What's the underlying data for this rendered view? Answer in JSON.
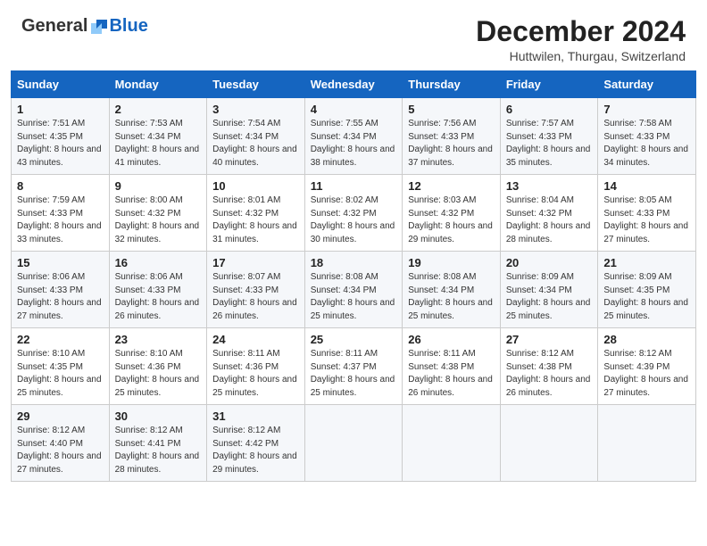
{
  "header": {
    "logo_general": "General",
    "logo_blue": "Blue",
    "month_title": "December 2024",
    "location": "Huttwilen, Thurgau, Switzerland"
  },
  "days_of_week": [
    "Sunday",
    "Monday",
    "Tuesday",
    "Wednesday",
    "Thursday",
    "Friday",
    "Saturday"
  ],
  "weeks": [
    [
      {
        "day": "1",
        "sunrise": "Sunrise: 7:51 AM",
        "sunset": "Sunset: 4:35 PM",
        "daylight": "Daylight: 8 hours and 43 minutes."
      },
      {
        "day": "2",
        "sunrise": "Sunrise: 7:53 AM",
        "sunset": "Sunset: 4:34 PM",
        "daylight": "Daylight: 8 hours and 41 minutes."
      },
      {
        "day": "3",
        "sunrise": "Sunrise: 7:54 AM",
        "sunset": "Sunset: 4:34 PM",
        "daylight": "Daylight: 8 hours and 40 minutes."
      },
      {
        "day": "4",
        "sunrise": "Sunrise: 7:55 AM",
        "sunset": "Sunset: 4:34 PM",
        "daylight": "Daylight: 8 hours and 38 minutes."
      },
      {
        "day": "5",
        "sunrise": "Sunrise: 7:56 AM",
        "sunset": "Sunset: 4:33 PM",
        "daylight": "Daylight: 8 hours and 37 minutes."
      },
      {
        "day": "6",
        "sunrise": "Sunrise: 7:57 AM",
        "sunset": "Sunset: 4:33 PM",
        "daylight": "Daylight: 8 hours and 35 minutes."
      },
      {
        "day": "7",
        "sunrise": "Sunrise: 7:58 AM",
        "sunset": "Sunset: 4:33 PM",
        "daylight": "Daylight: 8 hours and 34 minutes."
      }
    ],
    [
      {
        "day": "8",
        "sunrise": "Sunrise: 7:59 AM",
        "sunset": "Sunset: 4:33 PM",
        "daylight": "Daylight: 8 hours and 33 minutes."
      },
      {
        "day": "9",
        "sunrise": "Sunrise: 8:00 AM",
        "sunset": "Sunset: 4:32 PM",
        "daylight": "Daylight: 8 hours and 32 minutes."
      },
      {
        "day": "10",
        "sunrise": "Sunrise: 8:01 AM",
        "sunset": "Sunset: 4:32 PM",
        "daylight": "Daylight: 8 hours and 31 minutes."
      },
      {
        "day": "11",
        "sunrise": "Sunrise: 8:02 AM",
        "sunset": "Sunset: 4:32 PM",
        "daylight": "Daylight: 8 hours and 30 minutes."
      },
      {
        "day": "12",
        "sunrise": "Sunrise: 8:03 AM",
        "sunset": "Sunset: 4:32 PM",
        "daylight": "Daylight: 8 hours and 29 minutes."
      },
      {
        "day": "13",
        "sunrise": "Sunrise: 8:04 AM",
        "sunset": "Sunset: 4:32 PM",
        "daylight": "Daylight: 8 hours and 28 minutes."
      },
      {
        "day": "14",
        "sunrise": "Sunrise: 8:05 AM",
        "sunset": "Sunset: 4:33 PM",
        "daylight": "Daylight: 8 hours and 27 minutes."
      }
    ],
    [
      {
        "day": "15",
        "sunrise": "Sunrise: 8:06 AM",
        "sunset": "Sunset: 4:33 PM",
        "daylight": "Daylight: 8 hours and 27 minutes."
      },
      {
        "day": "16",
        "sunrise": "Sunrise: 8:06 AM",
        "sunset": "Sunset: 4:33 PM",
        "daylight": "Daylight: 8 hours and 26 minutes."
      },
      {
        "day": "17",
        "sunrise": "Sunrise: 8:07 AM",
        "sunset": "Sunset: 4:33 PM",
        "daylight": "Daylight: 8 hours and 26 minutes."
      },
      {
        "day": "18",
        "sunrise": "Sunrise: 8:08 AM",
        "sunset": "Sunset: 4:34 PM",
        "daylight": "Daylight: 8 hours and 25 minutes."
      },
      {
        "day": "19",
        "sunrise": "Sunrise: 8:08 AM",
        "sunset": "Sunset: 4:34 PM",
        "daylight": "Daylight: 8 hours and 25 minutes."
      },
      {
        "day": "20",
        "sunrise": "Sunrise: 8:09 AM",
        "sunset": "Sunset: 4:34 PM",
        "daylight": "Daylight: 8 hours and 25 minutes."
      },
      {
        "day": "21",
        "sunrise": "Sunrise: 8:09 AM",
        "sunset": "Sunset: 4:35 PM",
        "daylight": "Daylight: 8 hours and 25 minutes."
      }
    ],
    [
      {
        "day": "22",
        "sunrise": "Sunrise: 8:10 AM",
        "sunset": "Sunset: 4:35 PM",
        "daylight": "Daylight: 8 hours and 25 minutes."
      },
      {
        "day": "23",
        "sunrise": "Sunrise: 8:10 AM",
        "sunset": "Sunset: 4:36 PM",
        "daylight": "Daylight: 8 hours and 25 minutes."
      },
      {
        "day": "24",
        "sunrise": "Sunrise: 8:11 AM",
        "sunset": "Sunset: 4:36 PM",
        "daylight": "Daylight: 8 hours and 25 minutes."
      },
      {
        "day": "25",
        "sunrise": "Sunrise: 8:11 AM",
        "sunset": "Sunset: 4:37 PM",
        "daylight": "Daylight: 8 hours and 25 minutes."
      },
      {
        "day": "26",
        "sunrise": "Sunrise: 8:11 AM",
        "sunset": "Sunset: 4:38 PM",
        "daylight": "Daylight: 8 hours and 26 minutes."
      },
      {
        "day": "27",
        "sunrise": "Sunrise: 8:12 AM",
        "sunset": "Sunset: 4:38 PM",
        "daylight": "Daylight: 8 hours and 26 minutes."
      },
      {
        "day": "28",
        "sunrise": "Sunrise: 8:12 AM",
        "sunset": "Sunset: 4:39 PM",
        "daylight": "Daylight: 8 hours and 27 minutes."
      }
    ],
    [
      {
        "day": "29",
        "sunrise": "Sunrise: 8:12 AM",
        "sunset": "Sunset: 4:40 PM",
        "daylight": "Daylight: 8 hours and 27 minutes."
      },
      {
        "day": "30",
        "sunrise": "Sunrise: 8:12 AM",
        "sunset": "Sunset: 4:41 PM",
        "daylight": "Daylight: 8 hours and 28 minutes."
      },
      {
        "day": "31",
        "sunrise": "Sunrise: 8:12 AM",
        "sunset": "Sunset: 4:42 PM",
        "daylight": "Daylight: 8 hours and 29 minutes."
      },
      null,
      null,
      null,
      null
    ]
  ]
}
